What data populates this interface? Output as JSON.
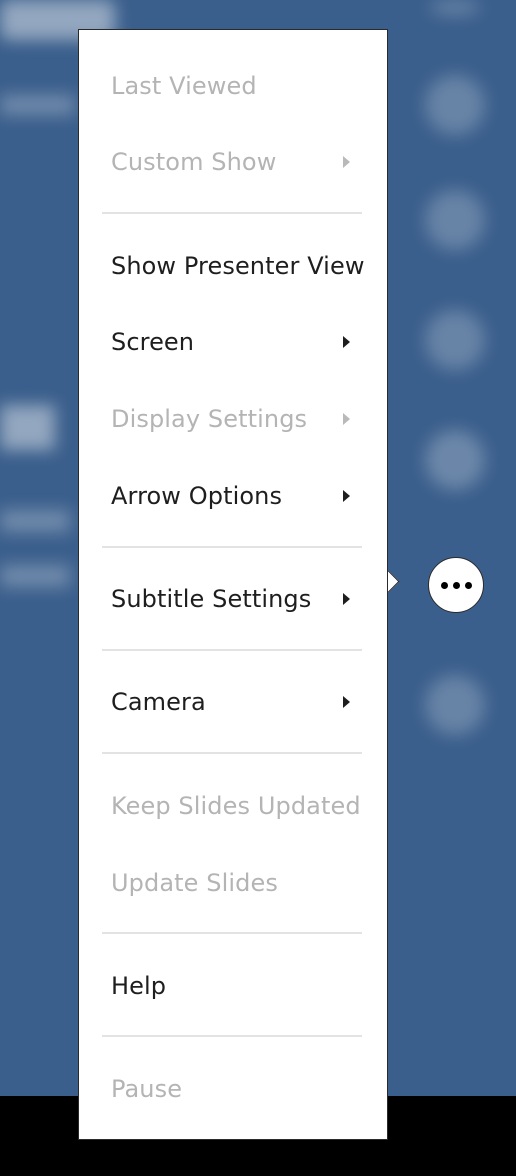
{
  "menu": {
    "items": [
      {
        "label": "Last Viewed",
        "enabled": false,
        "submenu": false
      },
      {
        "label": "Custom Show",
        "enabled": false,
        "submenu": true
      },
      {
        "label": "Show Presenter View",
        "enabled": true,
        "submenu": false
      },
      {
        "label": "Screen",
        "enabled": true,
        "submenu": true
      },
      {
        "label": "Display Settings",
        "enabled": false,
        "submenu": true
      },
      {
        "label": "Arrow Options",
        "enabled": true,
        "submenu": true
      },
      {
        "label": "Subtitle Settings",
        "enabled": true,
        "submenu": true
      },
      {
        "label": "Camera",
        "enabled": true,
        "submenu": true
      },
      {
        "label": "Keep Slides Updated",
        "enabled": false,
        "submenu": false
      },
      {
        "label": "Update Slides",
        "enabled": false,
        "submenu": false
      },
      {
        "label": "Help",
        "enabled": true,
        "submenu": false
      },
      {
        "label": "Pause",
        "enabled": false,
        "submenu": false
      }
    ]
  },
  "more_button": {
    "icon": "more-options-icon"
  },
  "colors": {
    "slide_background": "#3b5f8c",
    "disabled_text": "#b4b4b4",
    "enabled_text": "#1e1e1e"
  }
}
